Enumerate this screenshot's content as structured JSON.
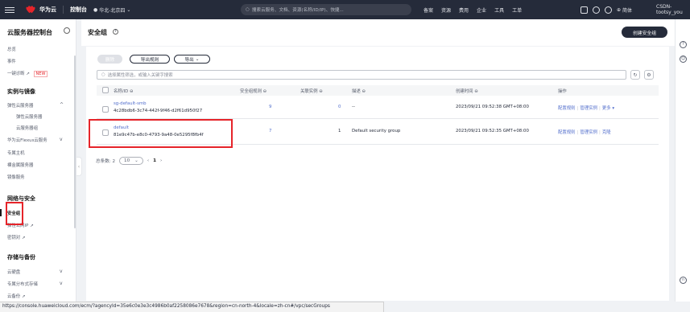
{
  "topbar": {
    "brand": "华为云",
    "console": "控制台",
    "region": "华北-北京四",
    "search_placeholder": "搜索云服务、文档、资源(名称/ID/IP)、快捷...",
    "links": [
      "备案",
      "资源",
      "费用",
      "企业",
      "工具",
      "工单"
    ],
    "language": "简体",
    "user": "CSDN-tootsy_you"
  },
  "sidebar": {
    "title": "云服务器控制台",
    "items": {
      "overview": "总览",
      "events": "事件",
      "diagnose": "一键诊断",
      "new_badge": "NEW",
      "instances_group": "实例与镜像",
      "ecs": "弹性云服务器",
      "ecs_sub1": "弹性云服务器",
      "ecs_sub2": "云服务器组",
      "flexus": "华为云Flexus云服务",
      "dedicated_host": "专属主机",
      "bare_metal": "裸金属服务器",
      "image": "镜像服务",
      "network_group": "网络与安全",
      "security_group": "安全组",
      "eip": "弹性公网IP",
      "keypair": "密钥对",
      "storage_group": "存储与备份",
      "evs": "云硬盘",
      "dss": "专属分布式存储",
      "cbr": "云备份"
    }
  },
  "page": {
    "title": "安全组",
    "create_button": "创建安全组",
    "delete_button": "删除",
    "export_rules_button": "导出规则",
    "export_button": "导出",
    "search_placeholder": "选择属性筛选，或输入关键字搜索"
  },
  "table": {
    "headers": {
      "name": "名称/ID",
      "rules": "安全组规则",
      "instances": "关联实例",
      "description": "描述",
      "created": "创建时间",
      "actions": "操作"
    },
    "rows": [
      {
        "name": "sg-default-smb",
        "id": "4c28bdb6-3c74-442f-9f46-d2f61d950f27",
        "rules": "9",
        "instances": "0",
        "description": "--",
        "created": "2023/09/21 09:52:38 GMT+08:00",
        "action1": "配置规则",
        "action2": "管理实例",
        "action3": "更多"
      },
      {
        "name": "default",
        "id": "81e9c47b-e8c0-4793-9a48-0e5295f8fb4f",
        "rules": "7",
        "instances": "1",
        "description": "Default security group",
        "created": "2023/09/21 09:52:35 GMT+08:00",
        "action1": "配置规则",
        "action2": "管理实例",
        "action3": "克隆"
      }
    ]
  },
  "pagination": {
    "total_label": "总条数: 2",
    "page_size": "10",
    "current_page": "1"
  },
  "statusbar": {
    "url": "https://console.huaweicloud.com/ecm/?agencyId=35e6c0e3e3c4986b0af2258086e7678&region=cn-north-4&locale=zh-cn#/vpc/secGroups"
  },
  "colors": {
    "topbar": "#252b3a",
    "accent_link": "#526ecc",
    "highlight": "#e6242a"
  }
}
